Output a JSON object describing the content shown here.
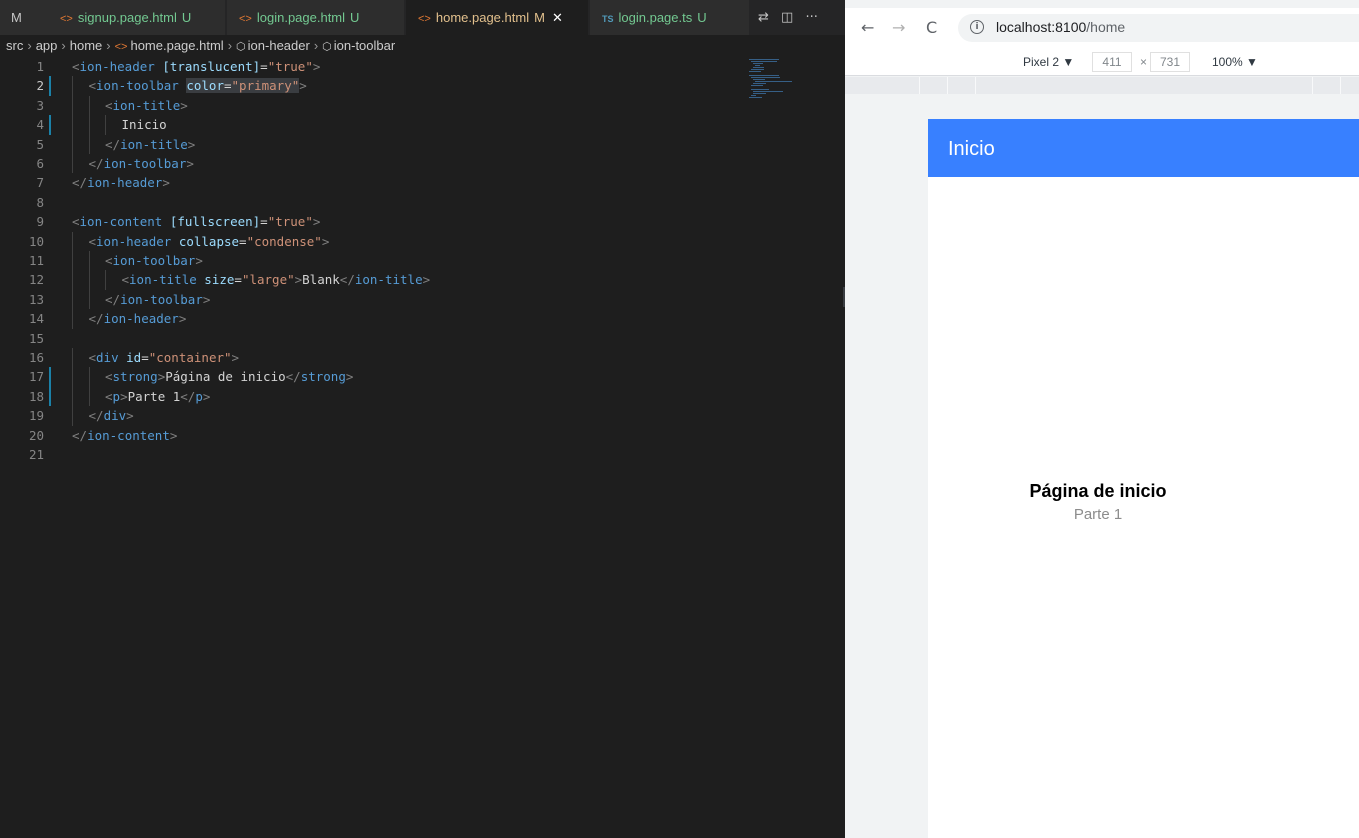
{
  "editor": {
    "edge_label": "M",
    "tabs": [
      {
        "label": "signup.page.html",
        "badge": "U",
        "icon": "html-icon",
        "color": "#73c991",
        "active": false
      },
      {
        "label": "login.page.html",
        "badge": "U",
        "icon": "html-icon",
        "color": "#73c991",
        "active": false
      },
      {
        "label": "home.page.html",
        "badge": "M",
        "icon": "html-icon",
        "color": "#e2c08d",
        "active": true,
        "close": "✕"
      },
      {
        "label": "login.page.ts",
        "badge": "U",
        "icon": "typescript-icon",
        "icon_text": "TS",
        "color": "#73c991",
        "active": false
      }
    ],
    "actions": {
      "compare": "⇄",
      "split": "◫",
      "more": "···"
    },
    "breadcrumb": [
      "src",
      "app",
      "home",
      "home.page.html",
      "ion-header",
      "ion-toolbar"
    ],
    "breadcrumb_sep": "›",
    "lines": [
      {
        "n": "1",
        "indent": 0,
        "tokens": [
          [
            "p",
            "<"
          ],
          [
            "t",
            "ion-header"
          ],
          [
            "x",
            " "
          ],
          [
            "a",
            "[translucent]"
          ],
          [
            "x",
            "="
          ],
          [
            "s",
            "\"true\""
          ],
          [
            "p",
            ">"
          ]
        ]
      },
      {
        "n": "2",
        "indent": 1,
        "current": true,
        "modified": true,
        "tokens": [
          [
            "p",
            "<"
          ],
          [
            "t",
            "ion-toolbar"
          ],
          [
            "x",
            " "
          ],
          [
            "ah",
            "color"
          ],
          [
            "xh",
            "="
          ],
          [
            "sh",
            "\"primary\""
          ],
          [
            "p",
            ">"
          ]
        ]
      },
      {
        "n": "3",
        "indent": 2,
        "tokens": [
          [
            "p",
            "<"
          ],
          [
            "t",
            "ion-title"
          ],
          [
            "p",
            ">"
          ]
        ]
      },
      {
        "n": "4",
        "indent": 3,
        "modified": true,
        "tokens": [
          [
            "x",
            "Inicio"
          ]
        ]
      },
      {
        "n": "5",
        "indent": 2,
        "tokens": [
          [
            "p",
            "</"
          ],
          [
            "t",
            "ion-title"
          ],
          [
            "p",
            ">"
          ]
        ]
      },
      {
        "n": "6",
        "indent": 1,
        "tokens": [
          [
            "p",
            "</"
          ],
          [
            "t",
            "ion-toolbar"
          ],
          [
            "p",
            ">"
          ]
        ]
      },
      {
        "n": "7",
        "indent": 0,
        "tokens": [
          [
            "p",
            "</"
          ],
          [
            "t",
            "ion-header"
          ],
          [
            "p",
            ">"
          ]
        ]
      },
      {
        "n": "8",
        "indent": 0,
        "tokens": []
      },
      {
        "n": "9",
        "indent": 0,
        "tokens": [
          [
            "p",
            "<"
          ],
          [
            "t",
            "ion-content"
          ],
          [
            "x",
            " "
          ],
          [
            "a",
            "[fullscreen]"
          ],
          [
            "x",
            "="
          ],
          [
            "s",
            "\"true\""
          ],
          [
            "p",
            ">"
          ]
        ]
      },
      {
        "n": "10",
        "indent": 1,
        "tokens": [
          [
            "p",
            "<"
          ],
          [
            "t",
            "ion-header"
          ],
          [
            "x",
            " "
          ],
          [
            "a",
            "collapse"
          ],
          [
            "x",
            "="
          ],
          [
            "s",
            "\"condense\""
          ],
          [
            "p",
            ">"
          ]
        ]
      },
      {
        "n": "11",
        "indent": 2,
        "tokens": [
          [
            "p",
            "<"
          ],
          [
            "t",
            "ion-toolbar"
          ],
          [
            "p",
            ">"
          ]
        ]
      },
      {
        "n": "12",
        "indent": 3,
        "tokens": [
          [
            "p",
            "<"
          ],
          [
            "t",
            "ion-title"
          ],
          [
            "x",
            " "
          ],
          [
            "a",
            "size"
          ],
          [
            "x",
            "="
          ],
          [
            "s",
            "\"large\""
          ],
          [
            "p",
            ">"
          ],
          [
            "x",
            "Blank"
          ],
          [
            "p",
            "</"
          ],
          [
            "t",
            "ion-title"
          ],
          [
            "p",
            ">"
          ]
        ]
      },
      {
        "n": "13",
        "indent": 2,
        "tokens": [
          [
            "p",
            "</"
          ],
          [
            "t",
            "ion-toolbar"
          ],
          [
            "p",
            ">"
          ]
        ]
      },
      {
        "n": "14",
        "indent": 1,
        "tokens": [
          [
            "p",
            "</"
          ],
          [
            "t",
            "ion-header"
          ],
          [
            "p",
            ">"
          ]
        ]
      },
      {
        "n": "15",
        "indent": 0,
        "tokens": []
      },
      {
        "n": "16",
        "indent": 1,
        "tokens": [
          [
            "p",
            "<"
          ],
          [
            "t",
            "div"
          ],
          [
            "x",
            " "
          ],
          [
            "a",
            "id"
          ],
          [
            "x",
            "="
          ],
          [
            "s",
            "\"container\""
          ],
          [
            "p",
            ">"
          ]
        ]
      },
      {
        "n": "17",
        "indent": 2,
        "modified": true,
        "tokens": [
          [
            "p",
            "<"
          ],
          [
            "t",
            "strong"
          ],
          [
            "p",
            ">"
          ],
          [
            "x",
            "Página de inicio"
          ],
          [
            "p",
            "</"
          ],
          [
            "t",
            "strong"
          ],
          [
            "p",
            ">"
          ]
        ]
      },
      {
        "n": "18",
        "indent": 2,
        "modified": true,
        "tokens": [
          [
            "p",
            "<"
          ],
          [
            "t",
            "p"
          ],
          [
            "p",
            ">"
          ],
          [
            "x",
            "Parte 1"
          ],
          [
            "p",
            "</"
          ],
          [
            "t",
            "p"
          ],
          [
            "p",
            ">"
          ]
        ]
      },
      {
        "n": "19",
        "indent": 1,
        "tokens": [
          [
            "p",
            "</"
          ],
          [
            "t",
            "div"
          ],
          [
            "p",
            ">"
          ]
        ]
      },
      {
        "n": "20",
        "indent": 0,
        "tokens": [
          [
            "p",
            "</"
          ],
          [
            "t",
            "ion-content"
          ],
          [
            "p",
            ">"
          ]
        ]
      },
      {
        "n": "21",
        "indent": 0,
        "tokens": []
      }
    ]
  },
  "browser": {
    "back": "←",
    "forward": "→",
    "reload": "C",
    "info": "i",
    "url_host": "localhost:8100",
    "url_path": "/home",
    "device": "Pixel 2 ▼",
    "width": "411",
    "times": "×",
    "height": "731",
    "zoom": "100% ▼",
    "app": {
      "toolbar_title": "Inicio",
      "toolbar_color": "#3880ff",
      "heading": "Página de inicio",
      "paragraph": "Parte 1"
    }
  }
}
